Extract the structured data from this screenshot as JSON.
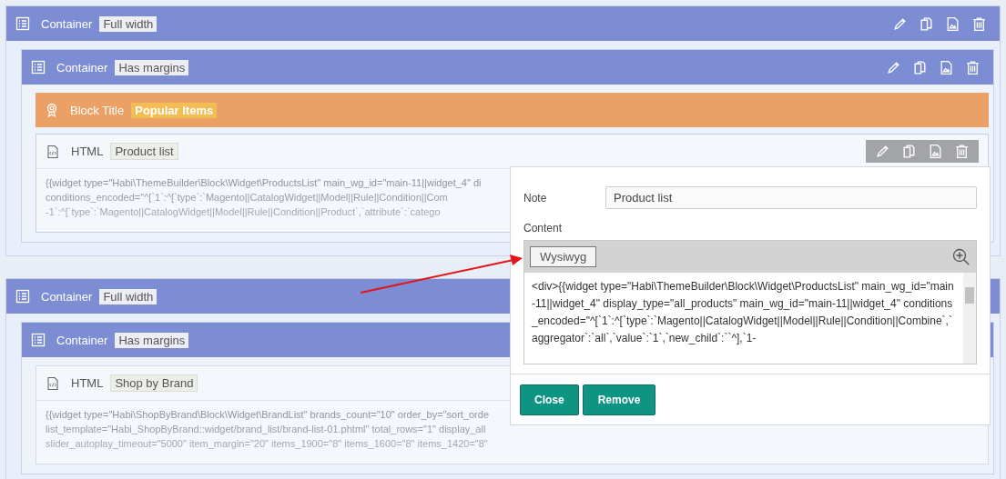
{
  "containers": [
    {
      "title": "Container",
      "tag": "Full width",
      "children": [
        {
          "title": "Container",
          "tag": "Has margins",
          "children": [
            {
              "kind": "block_title",
              "title": "Block Title",
              "tag": "Popular Items"
            },
            {
              "kind": "html",
              "title": "HTML",
              "tag": "Product list",
              "hovered": true,
              "code_lines": [
                "{{widget type=\"Habi\\ThemeBuilder\\Block\\Widget\\ProductsList\" main_wg_id=\"main-11||widget_4\" di",
                "conditions_encoded=\"^[`1`:^[`type`:`Magento||CatalogWidget||Model||Rule||Condition||Com",
                "-1`:^[`type`:`Magento||CatalogWidget||Model||Rule||Condition||Product`,`attribute`:`catego"
              ]
            }
          ]
        }
      ]
    },
    {
      "title": "Container",
      "tag": "Full width",
      "children": [
        {
          "title": "Container",
          "tag": "Has margins",
          "children": [
            {
              "kind": "html",
              "title": "HTML",
              "tag": "Shop by Brand",
              "hovered": false,
              "code_lines": [
                "{{widget type=\"Habi\\ShopByBrand\\Block\\Widget\\BrandList\" brands_count=\"10\" order_by=\"sort_orde",
                "list_template=\"Habi_ShopByBrand::widget/brand_list/brand-list-01.phtml\" total_rows=\"1\" display_all",
                "slider_autoplay_timeout=\"5000\" item_margin=\"20\" items_1900=\"8\" items_1600=\"8\" items_1420=\"8\""
              ]
            }
          ]
        }
      ]
    }
  ],
  "popup": {
    "note_label": "Note",
    "note_value": "Product list",
    "content_label": "Content",
    "wysiwyg_button": "Wysiwyg",
    "content": "<div>{{widget type=\"Habi\\ThemeBuilder\\Block\\Widget\\ProductsList\" main_wg_id=\"main-11||widget_4\" display_type=\"all_products\" main_wg_id=\"main-11||widget_4\" conditions_encoded=\"^[`1`:^[`type`:`Magento||CatalogWidget||Model||Rule||Condition||Combine`,`aggregator`:`all`,`value`:`1`,`new_child`:``^],`1-",
    "buttons": [
      "Close",
      "Remove"
    ]
  }
}
